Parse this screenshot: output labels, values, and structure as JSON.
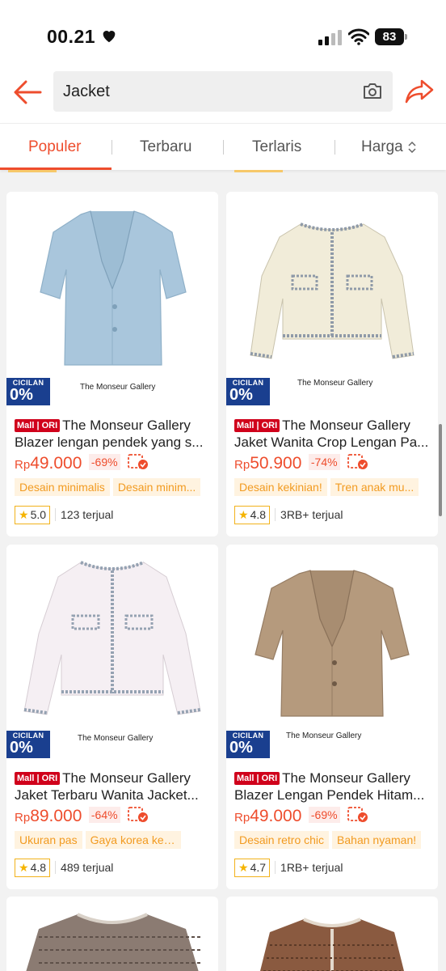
{
  "status_bar": {
    "time": "00.21",
    "battery": "83"
  },
  "search": {
    "query": "Jacket"
  },
  "tabs": [
    {
      "label": "Populer"
    },
    {
      "label": "Terbaru"
    },
    {
      "label": "Terlaris"
    },
    {
      "label": "Harga"
    }
  ],
  "products": [
    {
      "cicilan_label": "CICILAN",
      "cicilan_value": "0%",
      "image_caption": "The Monseur Gallery",
      "mall_badge": "Mall | ORI",
      "title_line1": "The Monseur Gallery",
      "title_line2": "Blazer lengan pendek yang s...",
      "currency": "Rp",
      "price": "49.000",
      "discount": "-69%",
      "tags": [
        "Desain minimalis",
        "Desain minim..."
      ],
      "rating": "5.0",
      "sold": "123 terjual"
    },
    {
      "cicilan_label": "CICILAN",
      "cicilan_value": "0%",
      "image_caption": "The Monseur Gallery",
      "mall_badge": "Mall | ORI",
      "title_line1": "The Monseur Gallery",
      "title_line2": "Jaket Wanita Crop Lengan Pa...",
      "currency": "Rp",
      "price": "50.900",
      "discount": "-74%",
      "tags": [
        "Desain kekinian!",
        "Tren anak mu..."
      ],
      "rating": "4.8",
      "sold": "3RB+ terjual"
    },
    {
      "cicilan_label": "CICILAN",
      "cicilan_value": "0%",
      "image_caption": "The Monseur Gallery",
      "mall_badge": "Mall | ORI",
      "title_line1": "The Monseur Gallery",
      "title_line2": "Jaket Terbaru Wanita Jacket...",
      "currency": "Rp",
      "price": "89.000",
      "discount": "-64%",
      "tags": [
        "Ukuran pas",
        "Gaya korea keren!"
      ],
      "rating": "4.8",
      "sold": "489 terjual"
    },
    {
      "cicilan_label": "CICILAN",
      "cicilan_value": "0%",
      "image_caption": "The Monseur Gallery",
      "mall_badge": "Mall | ORI",
      "title_line1": "The Monseur Gallery",
      "title_line2": "Blazer Lengan Pendek Hitam...",
      "currency": "Rp",
      "price": "49.000",
      "discount": "-69%",
      "tags": [
        "Desain retro chic",
        "Bahan nyaman!"
      ],
      "rating": "4.7",
      "sold": "1RB+ terjual"
    }
  ],
  "colors": {
    "accent": "#ee4d2d",
    "mall_badge": "#d0011b",
    "cicilan_bg": "#1a3f8f",
    "tag_text": "#f29b21"
  },
  "icons": [
    "heart-icon",
    "signal-icon",
    "wifi-icon",
    "battery-icon",
    "back-arrow-icon",
    "camera-icon",
    "share-icon",
    "sort-icon",
    "cod-icon",
    "star-icon"
  ]
}
